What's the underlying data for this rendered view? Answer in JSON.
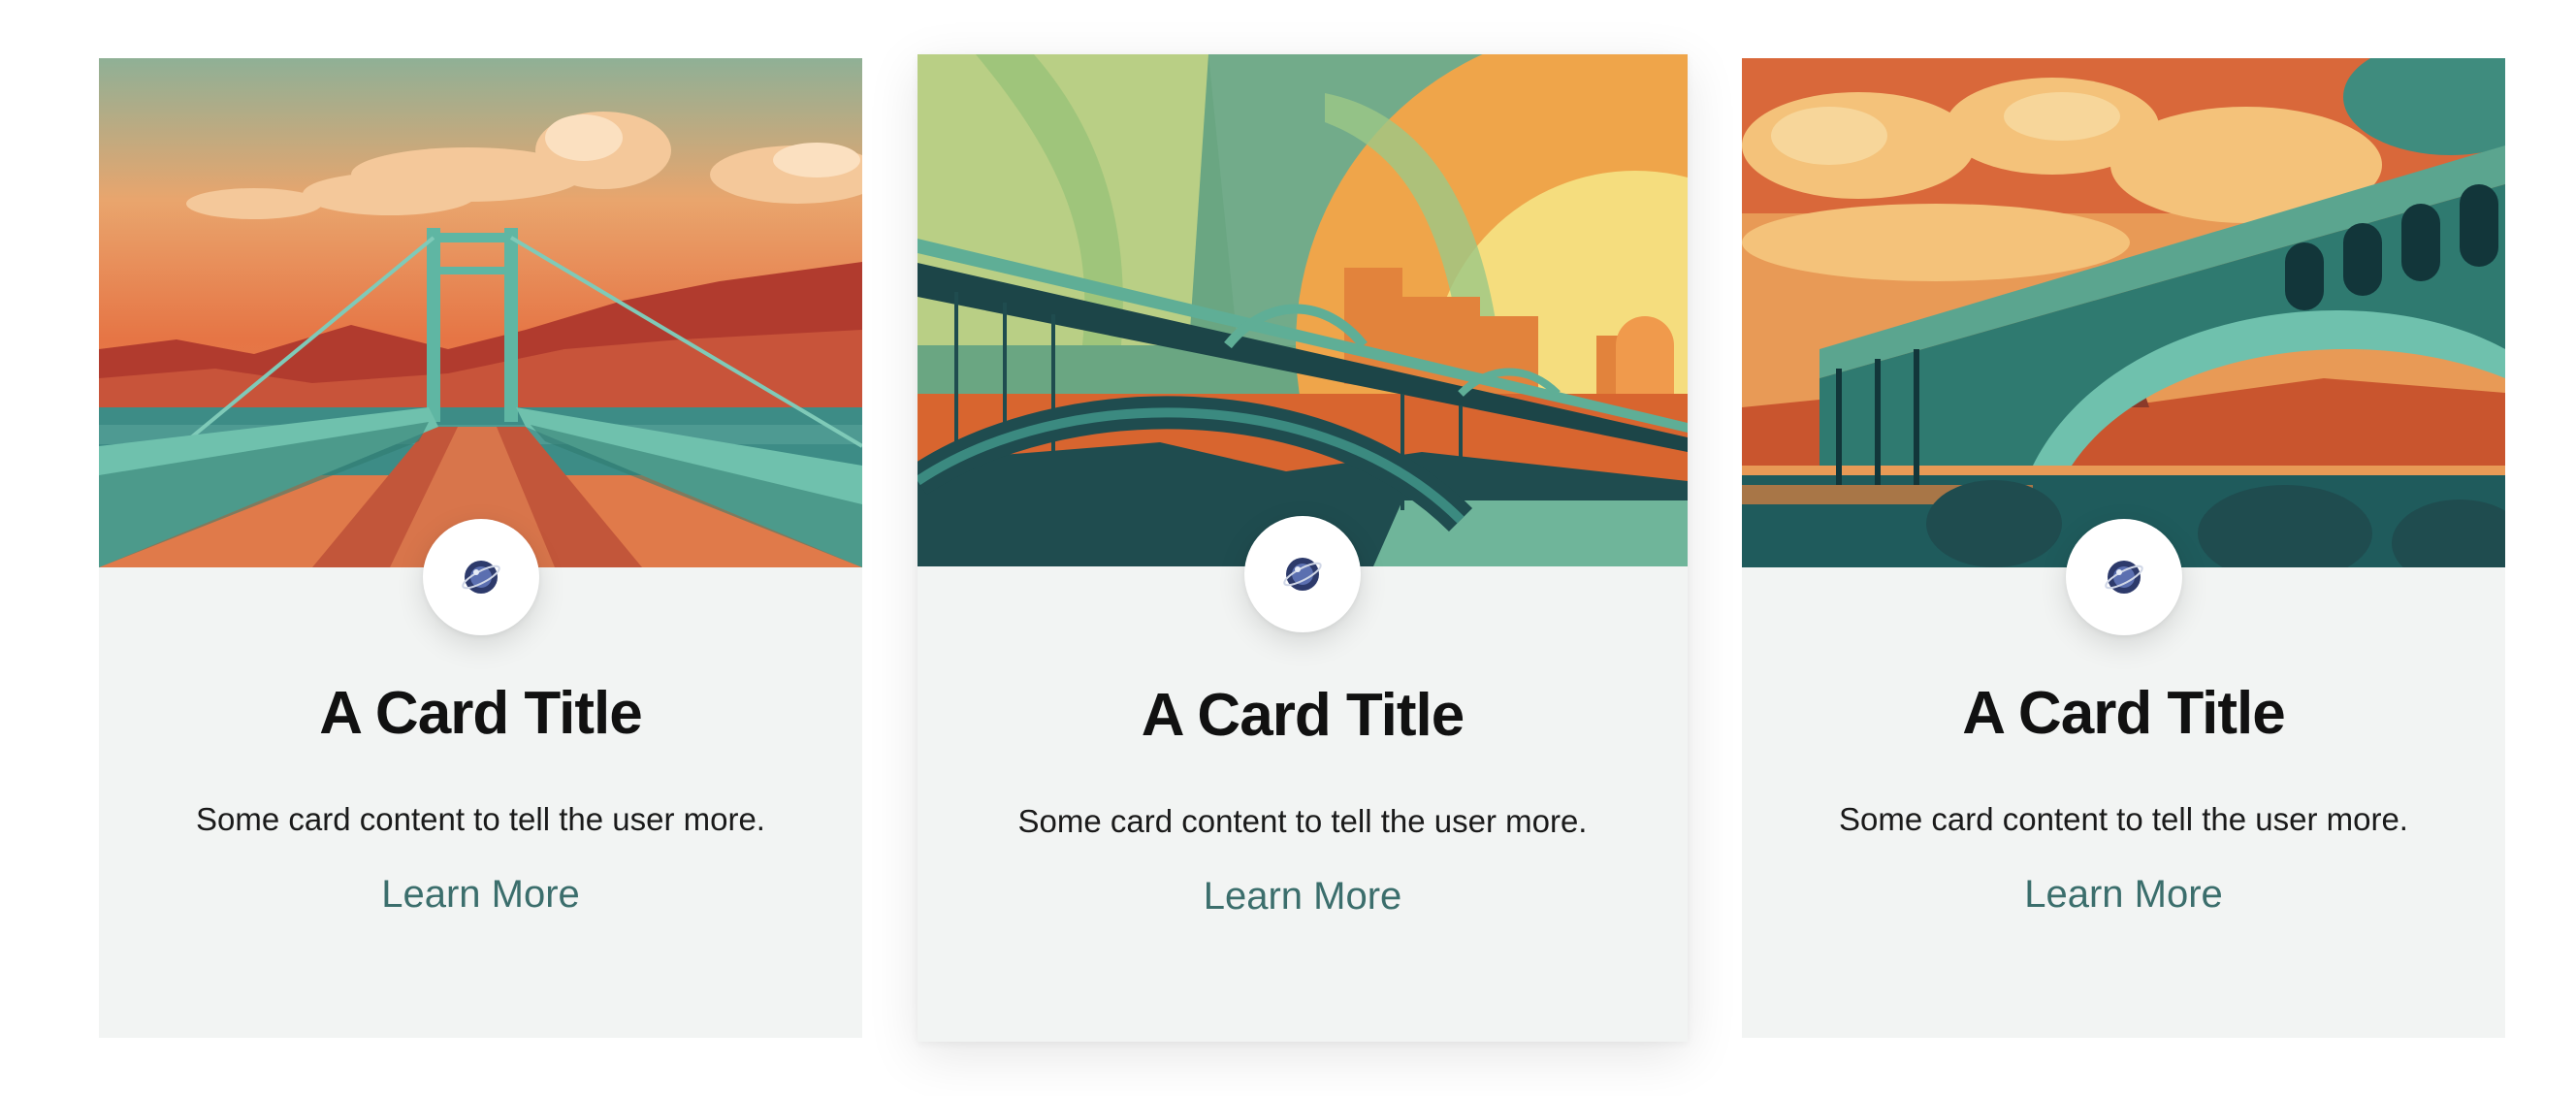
{
  "cards": [
    {
      "image": "suspension-bridge-sunset-illustration",
      "avatar_icon": "planet-icon",
      "title": "A Card Title",
      "text": "Some card content to tell the user more.",
      "link": "Learn More"
    },
    {
      "image": "arch-bridge-sunrise-illustration",
      "avatar_icon": "planet-icon",
      "title": "A Card Title",
      "text": "Some card content to tell the user more.",
      "link": "Learn More"
    },
    {
      "image": "stone-arch-bridge-clouds-illustration",
      "avatar_icon": "planet-icon",
      "title": "A Card Title",
      "text": "Some card content to tell the user more.",
      "link": "Learn More"
    }
  ],
  "colors": {
    "card_background": "#f2f4f3",
    "link": "#3b6e6c",
    "title": "#111111",
    "bridge_teal": "#6fc1ad",
    "sunset_orange": "#e8743f"
  }
}
